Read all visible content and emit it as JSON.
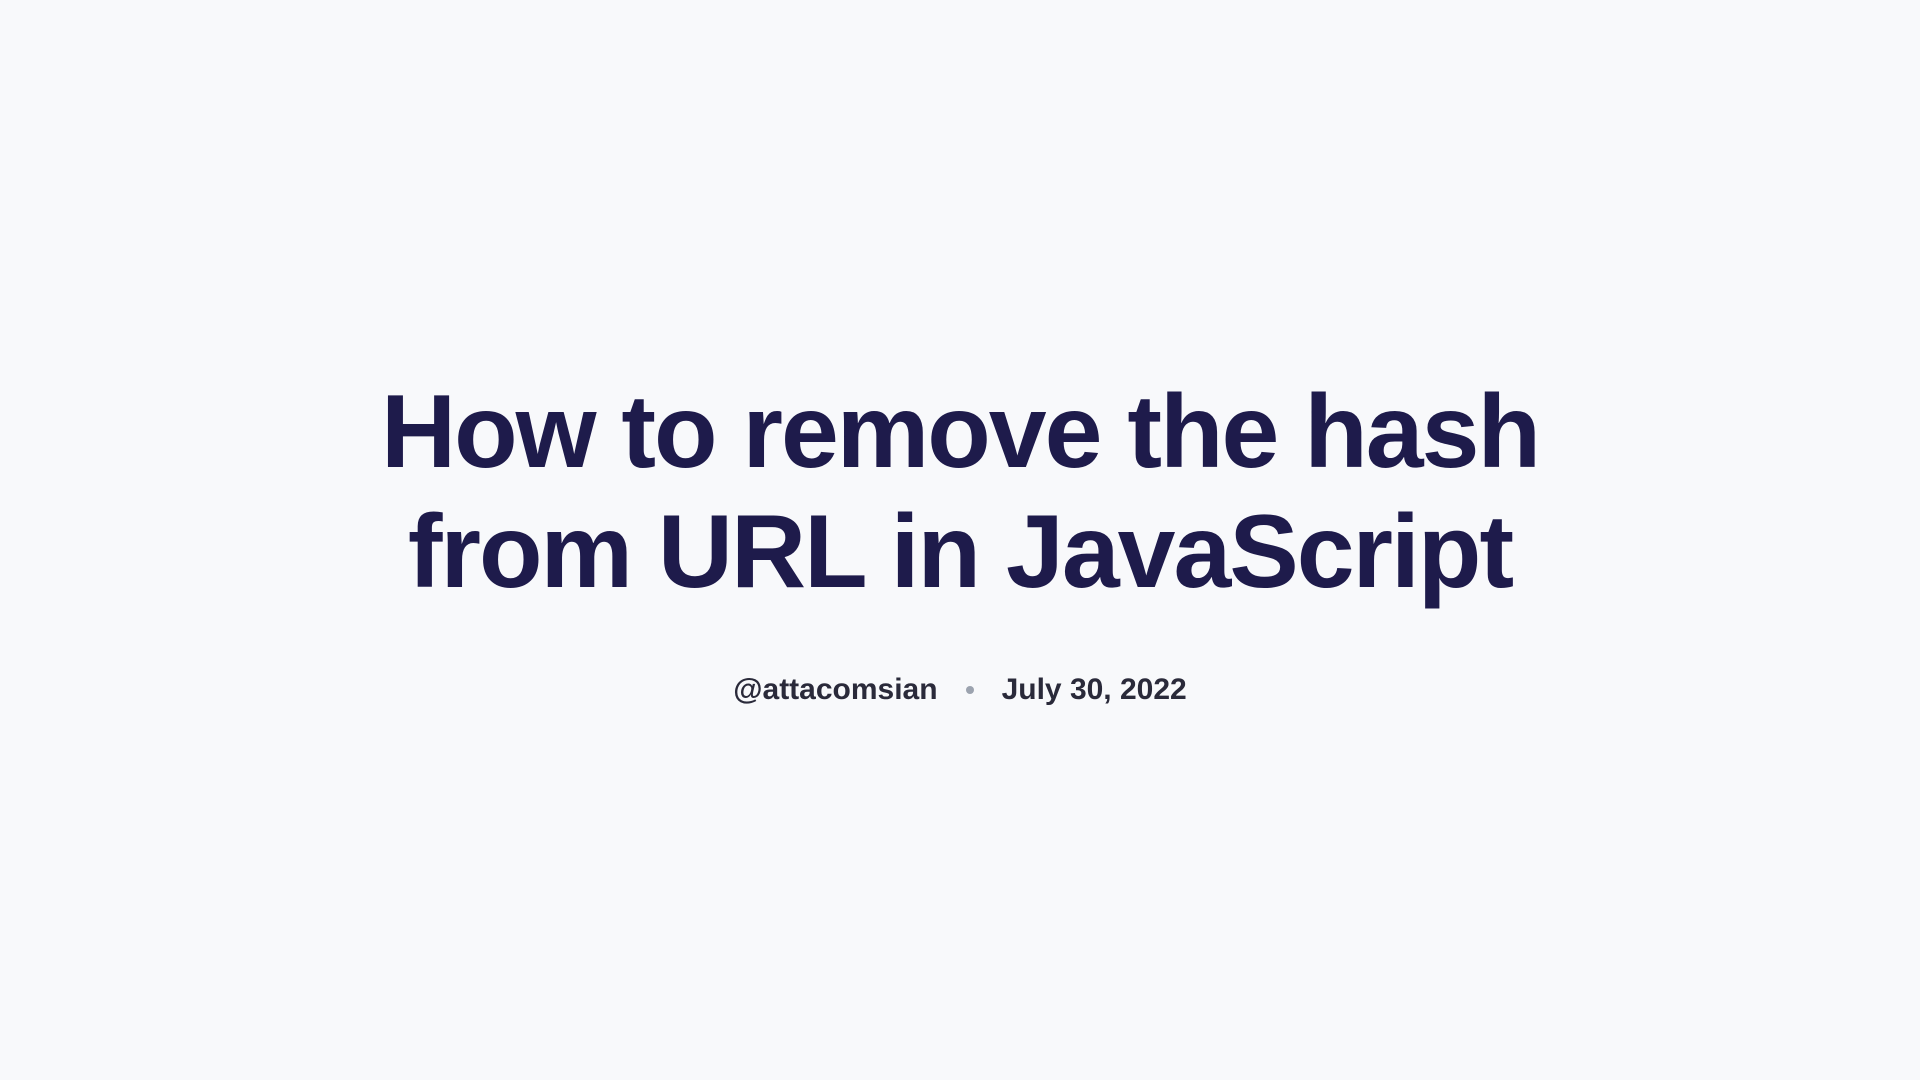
{
  "article": {
    "title": "How to remove the hash from URL in JavaScript",
    "author": "@attacomsian",
    "date": "July 30, 2022"
  }
}
